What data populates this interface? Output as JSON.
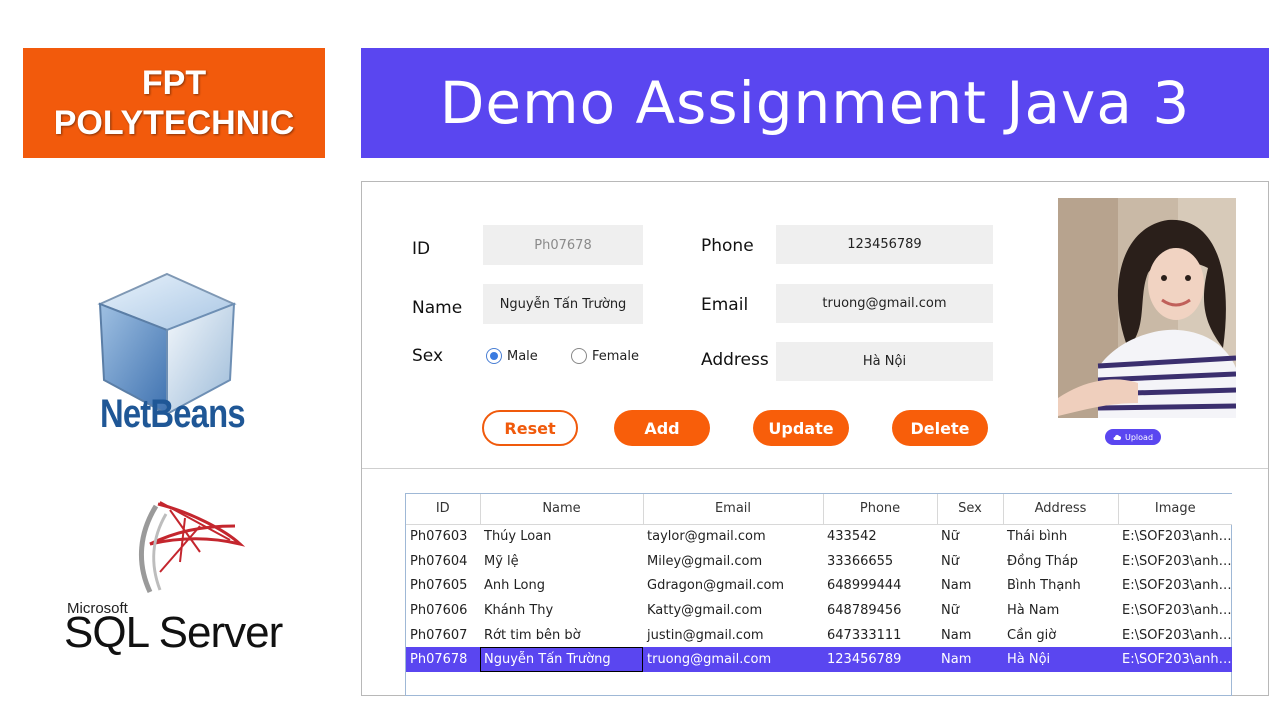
{
  "header": {
    "badge_line1": "FPT",
    "badge_line2": "POLYTECHNIC",
    "title": "Demo Assignment Java 3"
  },
  "logos": {
    "netbeans": "NetBeans",
    "microsoft": "Microsoft",
    "sql_server": "SQL Server"
  },
  "form": {
    "id_label": "ID",
    "id_value": "Ph07678",
    "name_label": "Name",
    "name_value": "Nguyễn Tấn Trường",
    "sex_label": "Sex",
    "sex_male": "Male",
    "sex_female": "Female",
    "sex_selected": "Male",
    "phone_label": "Phone",
    "phone_value": "123456789",
    "email_label": "Email",
    "email_value": "truong@gmail.com",
    "address_label": "Address",
    "address_value": "Hà Nội",
    "upload_label": "Upload"
  },
  "buttons": {
    "reset": "Reset",
    "add": "Add",
    "update": "Update",
    "delete": "Delete"
  },
  "colors": {
    "brand_orange": "#f25a0c",
    "banner_purple": "#5a46f0",
    "selection": "#5a46f0"
  },
  "table": {
    "columns": [
      "ID",
      "Name",
      "Email",
      "Phone",
      "Sex",
      "Address",
      "Image"
    ],
    "rows": [
      [
        "Ph07603",
        "Thúy Loan",
        "taylor@gmail.com",
        "433542",
        "Nữ",
        "Thái bình",
        "E:\\SOF203\\anhA..."
      ],
      [
        "Ph07604",
        "Mỹ lệ",
        "Miley@gmail.com",
        "33366655",
        "Nữ",
        "Đồng Tháp",
        "E:\\SOF203\\anhA..."
      ],
      [
        "Ph07605",
        "Anh Long",
        "Gdragon@gmail.com",
        "648999444",
        "Nam",
        "Bình Thạnh",
        "E:\\SOF203\\anhA..."
      ],
      [
        "Ph07606",
        "Khánh Thy",
        "Katty@gmail.com",
        "648789456",
        "Nữ",
        "Hà Nam",
        "E:\\SOF203\\anhA..."
      ],
      [
        "Ph07607",
        "Rớt tim bên bờ",
        "justin@gmail.com",
        "647333111",
        "Nam",
        "Cần giờ",
        "E:\\SOF203\\anhA..."
      ],
      [
        "Ph07678",
        "Nguyễn Tấn Trường",
        "truong@gmail.com",
        "123456789",
        "Nam",
        "Hà Nội",
        "E:\\SOF203\\anhA..."
      ]
    ],
    "selected_row": 5
  }
}
